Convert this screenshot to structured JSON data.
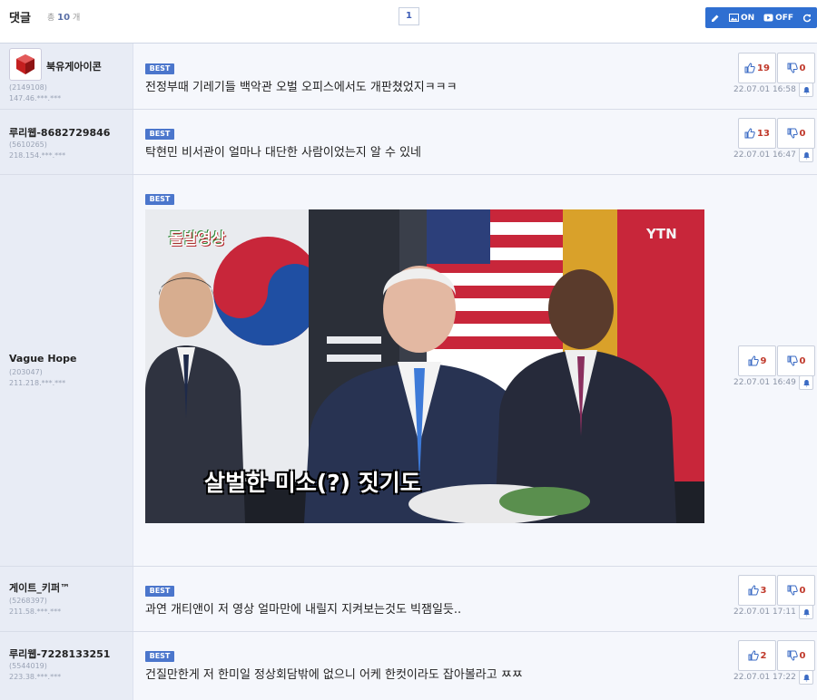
{
  "header": {
    "title": "댓글",
    "total_label": "총",
    "total_count": "10",
    "total_unit": "개",
    "page": "1",
    "image_on_label": "ON",
    "image_off_label": "OFF"
  },
  "comments": [
    {
      "nick": "북유게아이콘",
      "uid": "(2149108)",
      "ip": "147.46.***.***",
      "best": "BEST",
      "text": "전정부때 기레기들 백악관 오벌 오피스에서도 개판쳤었지ㅋㅋㅋ",
      "up": "19",
      "down": "0",
      "date": "22.07.01 16:58"
    },
    {
      "nick": "루리웹-8682729846",
      "uid": "(5610265)",
      "ip": "218.154.***.***",
      "best": "BEST",
      "text": "탁현민 비서관이 얼마나 대단한 사람이었는지 알 수 있네",
      "up": "13",
      "down": "0",
      "date": "22.07.01 16:47"
    },
    {
      "nick": "Vague Hope",
      "uid": "(203047)",
      "ip": "211.218.***.***",
      "best": "BEST",
      "image": {
        "logo_text": "돌발영상",
        "broadcaster": "YTN",
        "caption": "살벌한 미소(?) 짓기도"
      },
      "up": "9",
      "down": "0",
      "date": "22.07.01 16:49"
    },
    {
      "nick": "게이트_키퍼™",
      "uid": "(5268397)",
      "ip": "211.58.***.***",
      "best": "BEST",
      "text": "과연 개티앤이 저 영상 얼마만에 내릴지 지켜보는것도 빅잼일듯..",
      "up": "3",
      "down": "0",
      "date": "22.07.01 17:11"
    },
    {
      "nick": "루리웹-7228133251",
      "uid": "(5544019)",
      "ip": "223.38.***.***",
      "best": "BEST",
      "text": "건질만한게 저 한미일 정상회담밖에 없으니 어케 한컷이라도 잡아볼라고 ㅉㅉ",
      "up": "2",
      "down": "0",
      "date": "22.07.01 17:22"
    }
  ],
  "colors": {
    "accent": "#2f6fd1",
    "best_badge": "#4b76cc",
    "vote_count": "#c0392b"
  }
}
